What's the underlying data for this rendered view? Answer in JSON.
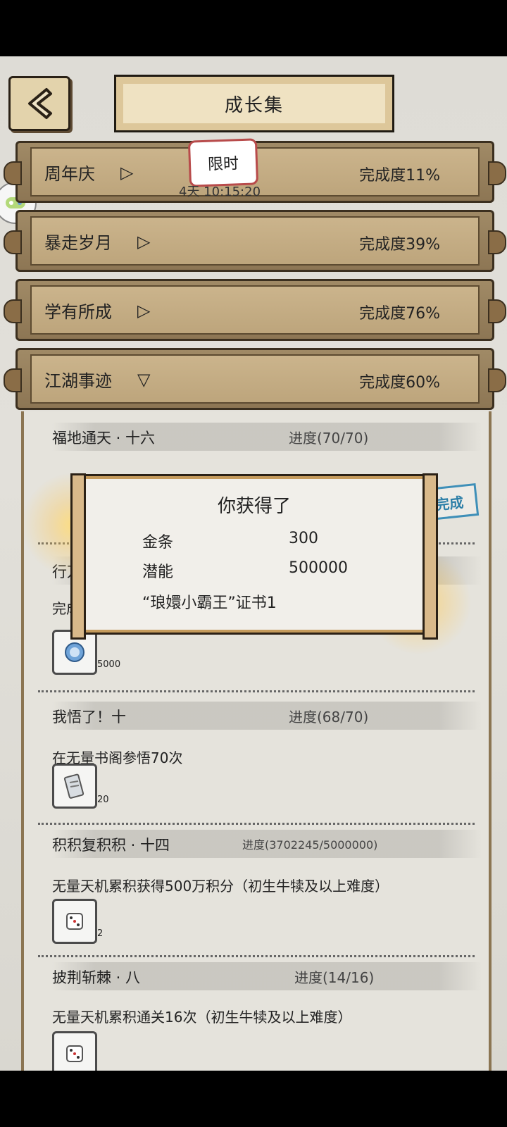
{
  "header": {
    "title": "成长集"
  },
  "categories": [
    {
      "name": "周年庆",
      "progress": "完成度11%",
      "badge": "限时",
      "timer": "4天 10:15:20",
      "expanded": false
    },
    {
      "name": "暴走岁月",
      "progress": "完成度39%",
      "expanded": false
    },
    {
      "name": "学有所成",
      "progress": "完成度76%",
      "expanded": false
    },
    {
      "name": "江湖事迹",
      "progress": "完成度60%",
      "expanded": true
    }
  ],
  "tasks": [
    {
      "name": "福地通天 · 十六",
      "progress": "进度(70/70)",
      "stamp": "完成"
    },
    {
      "name": "行万",
      "desc": "完成",
      "reward_qty": "5000",
      "reward_icon": "coin-icon"
    },
    {
      "name": "我悟了！十",
      "progress": "进度(68/70)",
      "desc": "在无量书阁参悟70次",
      "reward_qty": "20",
      "reward_icon": "certificate-icon"
    },
    {
      "name": "积积复积积 · 十四",
      "progress": "进度(3702245/5000000)",
      "desc": "无量天机累积获得500万积分（初生牛犊及以上难度）",
      "reward_qty": "2",
      "reward_icon": "dice-icon"
    },
    {
      "name": "披荆斩棘 · 八",
      "progress": "进度(14/16)",
      "desc": "无量天机累积通关16次（初生牛犊及以上难度）",
      "reward_icon": "dice-icon"
    }
  ],
  "popup": {
    "title": "你获得了",
    "items": [
      {
        "label": "金条",
        "value": "300"
      },
      {
        "label": "潜能",
        "value": "500000"
      }
    ],
    "cert": "“琅嬛小霸王”证书1"
  }
}
